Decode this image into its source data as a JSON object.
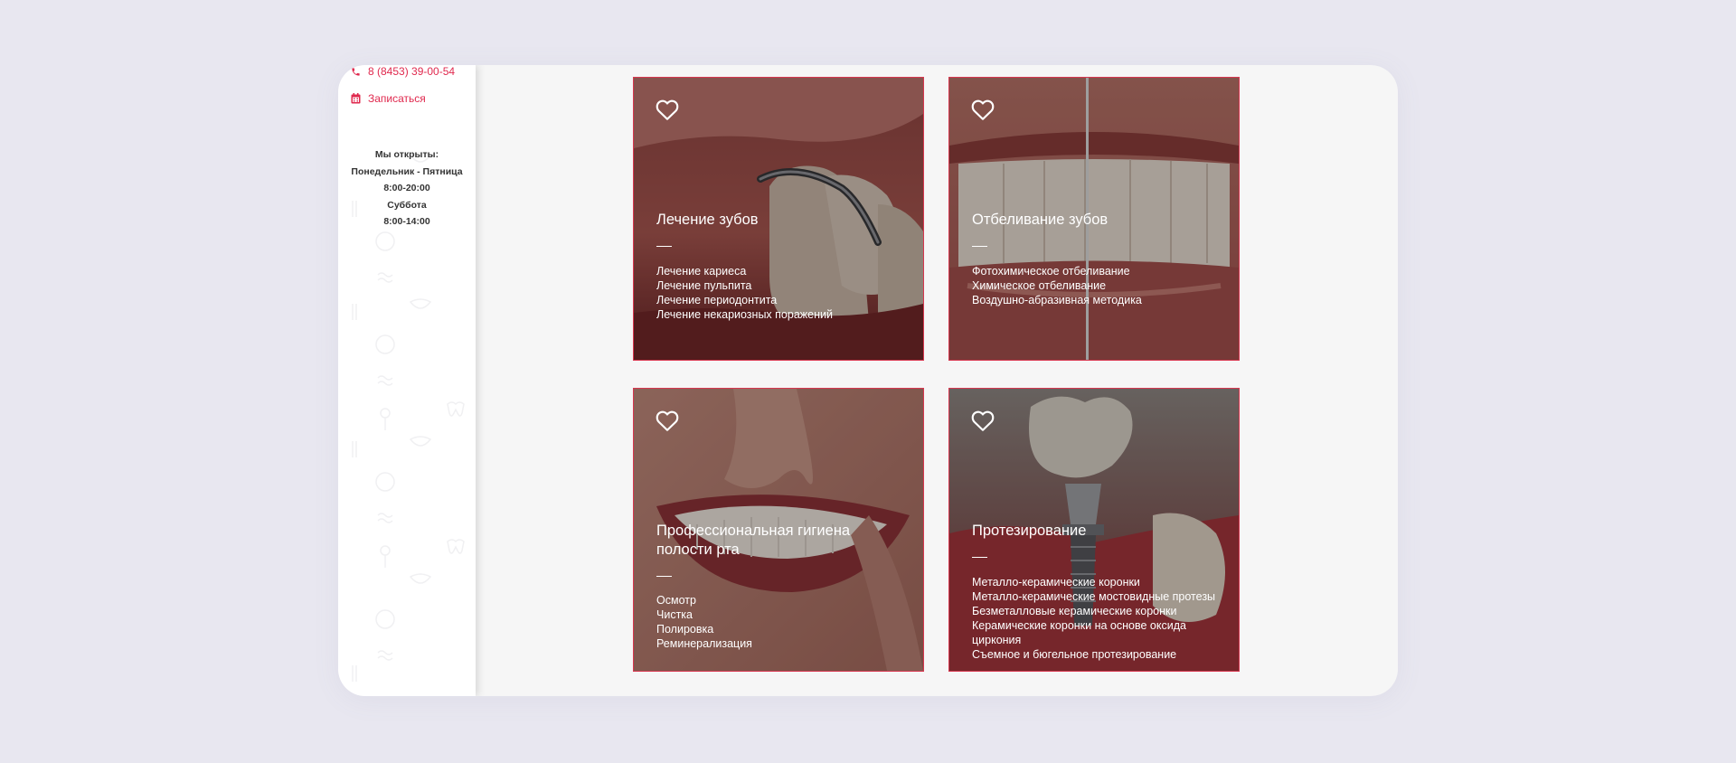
{
  "sidebar": {
    "phone": "8 (8453) 39-00-54",
    "book_label": "Записаться",
    "hours": {
      "heading": "Мы открыты:",
      "weekdays": "Понедельник - Пятница",
      "weekday_time": "8:00-20:00",
      "saturday": "Суббота",
      "saturday_time": "8:00-14:00"
    }
  },
  "services": [
    {
      "title": "Лечение зубов",
      "items": [
        "Лечение кариеса",
        "Лечение пульпита",
        "Лечение периодонтита",
        "Лечение некариозных поражений"
      ]
    },
    {
      "title": "Отбеливание зубов",
      "items": [
        "Фотохимическое отбеливание",
        "Химическое отбеливание",
        "Воздушно-абразивная методика"
      ]
    },
    {
      "title": "Профессиональная гигиена полости рта",
      "items": [
        "Осмотр",
        "Чистка",
        "Полировка",
        "Реминерализация"
      ]
    },
    {
      "title": "Протезирование",
      "items": [
        "Металло-керамические коронки",
        "Металло-керамические мостовидные протезы",
        "Безметалловые керамические коронки",
        "Керамические коронки на основе оксида циркония",
        "Съемное и бюгельное протезирование"
      ]
    }
  ],
  "colors": {
    "accent": "#e0294e",
    "card_border": "#d7374f",
    "page_bg": "#e8e7f0",
    "content_bg": "#f6f6f6"
  },
  "icons": {
    "phone": "phone-icon",
    "book": "calendar-icon",
    "favorite": "heart-icon"
  }
}
